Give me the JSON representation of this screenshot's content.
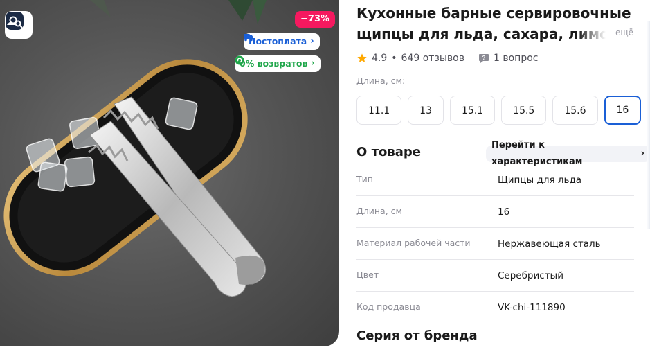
{
  "product": {
    "title_line1": "Кухонные барные сервировочные",
    "title_line2": "щипцы для льда, сахара, лимо",
    "more_label": "ещё"
  },
  "badges": {
    "discount": "−73%",
    "postpay": "Постоплата",
    "returns": "0% возвратов"
  },
  "rating": {
    "score": "4.9",
    "reviews": "649 отзывов",
    "questions": "1 вопрос"
  },
  "length": {
    "label": "Длина, см:",
    "options": [
      "11.1",
      "13",
      "15.1",
      "15.5",
      "15.6",
      "16"
    ],
    "selected": "16"
  },
  "about": {
    "title": "О товаре",
    "link_label": "Перейти к характеристикам",
    "specs": [
      {
        "name": "Тип",
        "value": "Щипцы для льда"
      },
      {
        "name": "Длина, см",
        "value": "16"
      },
      {
        "name": "Материал рабочей части",
        "value": "Нержавеющая сталь"
      },
      {
        "name": "Цвет",
        "value": "Серебристый"
      },
      {
        "name": "Код продавца",
        "value": "VK-chi-111890"
      }
    ]
  },
  "series": {
    "title": "Серия от бренда"
  },
  "colors": {
    "accent": "#1a5fd6",
    "discount": "#f5195f",
    "returns": "#1fa64a",
    "star": "#ffa800"
  }
}
